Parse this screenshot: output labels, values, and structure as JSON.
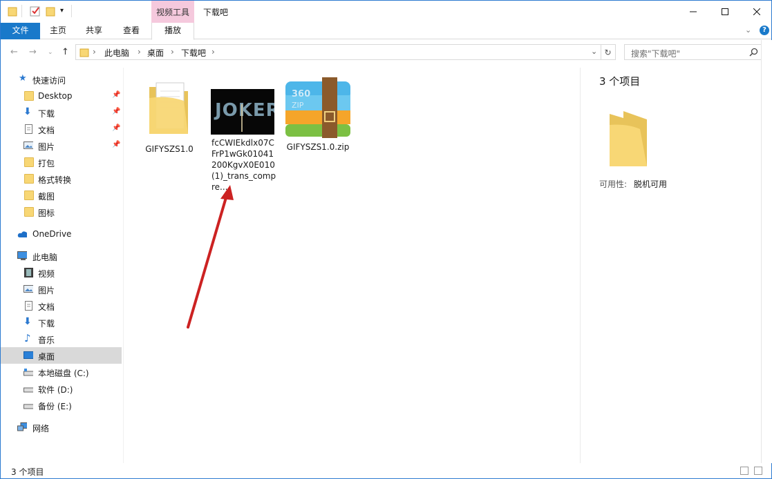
{
  "titlebar": {
    "context_tab": "视频工具",
    "title": "下载吧"
  },
  "ribbon": {
    "tabs": [
      "文件",
      "主页",
      "共享",
      "查看",
      "播放"
    ]
  },
  "address": {
    "crumbs": [
      "此电脑",
      "桌面",
      "下载吧"
    ],
    "search_placeholder": "搜索\"下载吧\""
  },
  "sidebar": {
    "quick_access": "快速访问",
    "quick_items": [
      "Desktop",
      "下载",
      "文档",
      "图片",
      "打包",
      "格式转换",
      "截图",
      "图标"
    ],
    "onedrive": "OneDrive",
    "this_pc": "此电脑",
    "pc_items": [
      "视频",
      "图片",
      "文档",
      "下载",
      "音乐",
      "桌面",
      "本地磁盘 (C:)",
      "软件 (D:)",
      "备份 (E:)"
    ],
    "network": "网络"
  },
  "files": [
    {
      "name": "GIFYSZS1.0",
      "type": "folder-icon"
    },
    {
      "name": "fcCWIEkdlx07CFrP1wGk01041200KgvX0E010(1)_trans_compre...",
      "type": "video-thumbnail-icon",
      "thumb_text": "JOKER"
    },
    {
      "name": "GIFYSZS1.0.zip",
      "type": "zip-archive-icon",
      "badge": "360 ZIP"
    }
  ],
  "details": {
    "count": "3 个项目",
    "availability_label": "可用性:",
    "availability_value": "脱机可用"
  },
  "status": {
    "count": "3 个项目"
  },
  "colors": {
    "accent": "#1979ca",
    "context_tab": "#f5c9dd",
    "selection": "#d9d9d9",
    "arrow": "#cc2222"
  }
}
